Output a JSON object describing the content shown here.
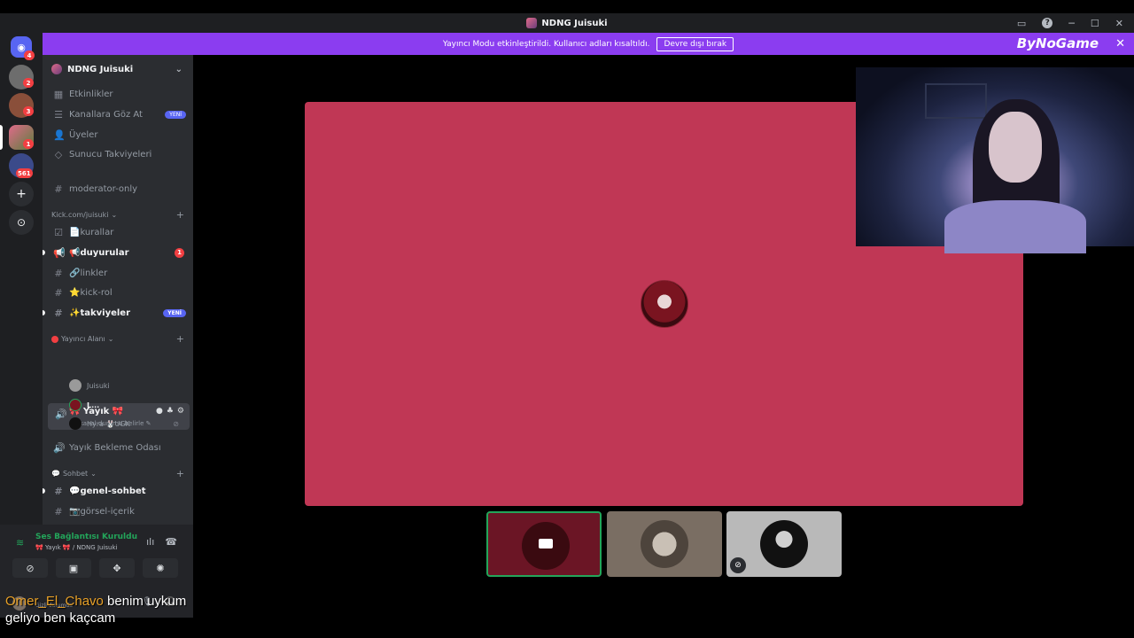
{
  "window": {
    "title": "NDNG Juisuki",
    "help": "?",
    "minimize": "─",
    "maximize": "☐",
    "close": "✕"
  },
  "banner": {
    "text": "Yayıncı Modu etkinleştirildi. Kullanıcı adları kısaltıldı.",
    "button": "Devre dışı bırak",
    "close": "✕",
    "watermark": "ByNoGame"
  },
  "rail": {
    "badges": [
      "4",
      "2",
      "3",
      "1",
      "561"
    ],
    "add": "+",
    "discover": "⊙"
  },
  "server": {
    "name": "NDNG Juisuki"
  },
  "nav": {
    "events": "Etkinlikler",
    "browse": "Kanallara Göz At",
    "browse_badge": "YENİ",
    "members": "Üyeler",
    "boosts": "Sunucu Takviyeleri",
    "moderator": "moderator-only"
  },
  "categories": {
    "kick": "Kick.com/juisuki",
    "streamer": "Yayıncı Alanı",
    "chat": "Sohbet"
  },
  "channels": {
    "kurallar": "📄kurallar",
    "duyurular": "📢duyurular",
    "duyurular_count": "1",
    "linkler": "🔗linkler",
    "kickrol": "⭐kick-rol",
    "takviyeler": "✨takviyeler",
    "takviyeler_badge": "YENİ",
    "voice": "🎀 Yayık 🎀",
    "voice_status": "Bir kanal durumu belirle ✎",
    "waiting": "Yayık Bekleme Odası",
    "genel": "💬genel-sohbet",
    "gorsel": "📷görsel-içerik"
  },
  "voice_users": [
    "Juisuki",
    "L...",
    "Hyra 🐰UGK"
  ],
  "voice_panel": {
    "status": "Ses Bağlantısı Kuruldu",
    "channel": "🎀 Yayık 🎀 / NDNG Juisuki"
  },
  "me": {
    "status": "Gizli durumda"
  },
  "chat_overlay": {
    "nick": "Omer_El_Chavo",
    "line1": " benim uykum",
    "line2": "geliyo ben kaçcam"
  },
  "colors": {
    "banner": "#8b3df0",
    "stage": "#c03755",
    "connected": "#23a55a",
    "badge": "#f23f42",
    "accent": "#5865f2"
  }
}
